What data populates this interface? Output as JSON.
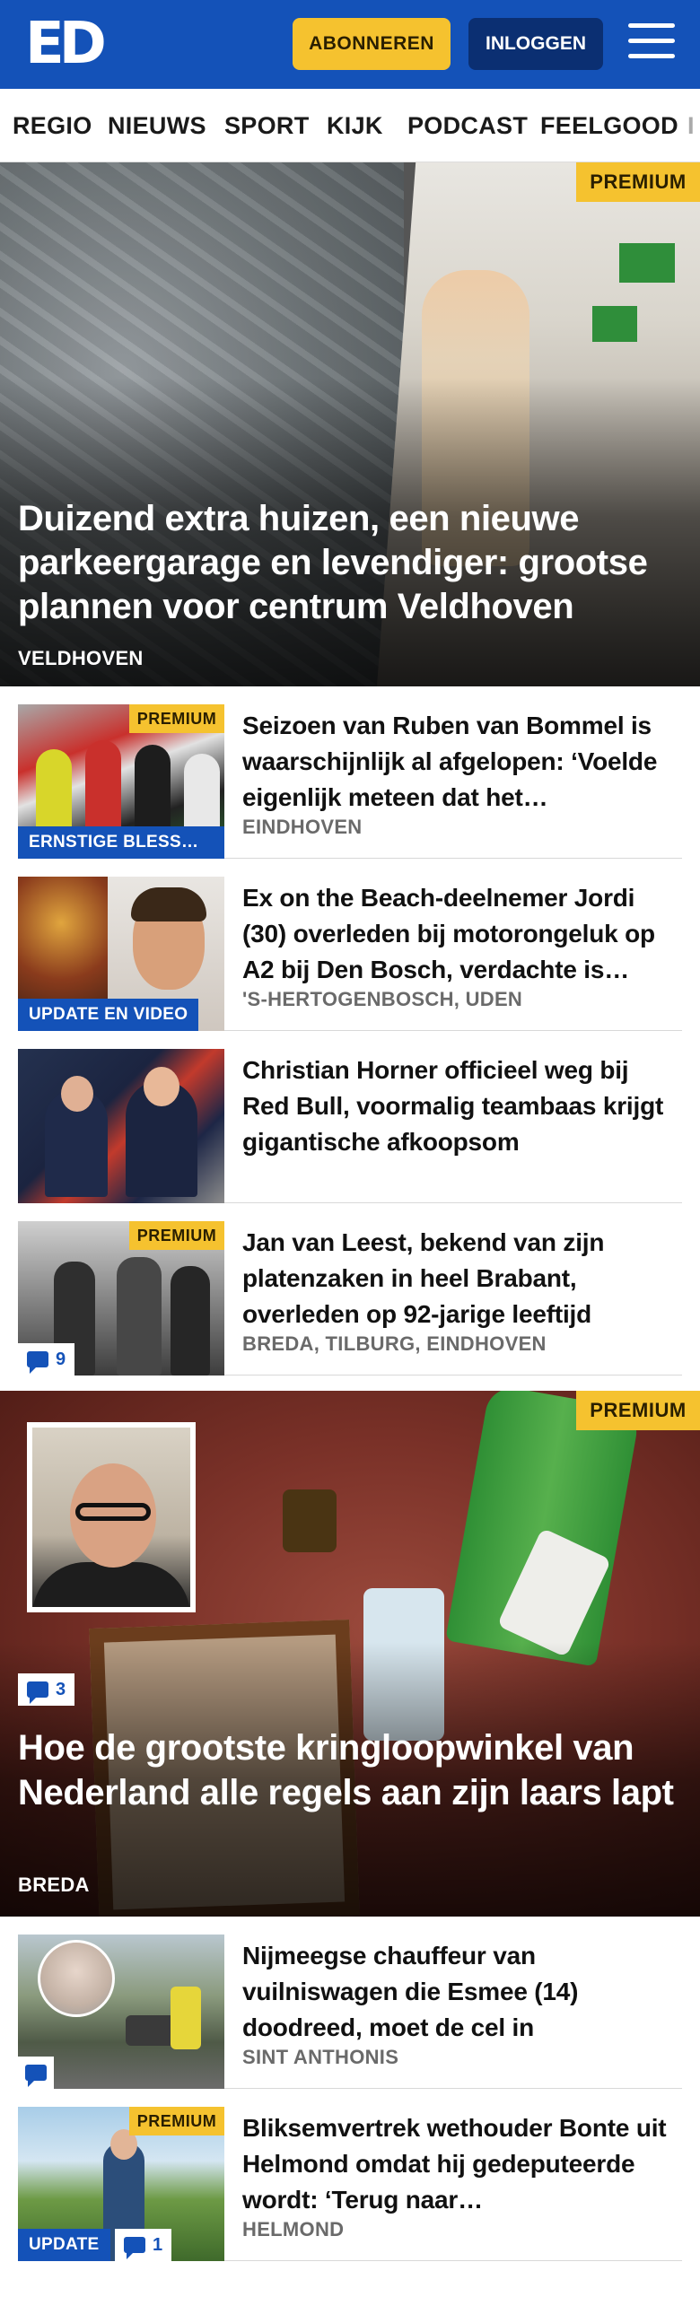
{
  "header": {
    "logo": "ED",
    "subscribe_label": "ABONNEREN",
    "login_label": "INLOGGEN"
  },
  "nav": {
    "items": [
      "REGIO",
      "NIEUWS",
      "SPORT",
      "KIJK",
      "PODCAST",
      "FEELGOOD",
      "I"
    ]
  },
  "hero": {
    "badge": "PREMIUM",
    "title": "Duizend extra huizen, een nieuwe parkeergarage en levendiger: grootse plannen voor centrum Veldhoven",
    "location": "VELDHOVEN"
  },
  "articles": [
    {
      "badge": "PREMIUM",
      "label": "ERNSTIGE BLESS…",
      "title": "Seizoen van Ruben van Bommel is waarschijnlijk al afgelopen: ‘Voelde eigenlijk meteen dat het…",
      "location": "EINDHOVEN"
    },
    {
      "label": "UPDATE EN VIDEO",
      "title": "Ex on the Beach-deelnemer Jordi (30) overleden bij motorongeluk op A2 bij Den Bosch, verdachte is…",
      "location": "'S-HERTOGENBOSCH, UDEN"
    },
    {
      "title": "Christian Horner officieel weg bij Red Bull, voormalig teambaas krijgt gigantische afkoopsom"
    },
    {
      "badge": "PREMIUM",
      "comments": "9",
      "title": "Jan van Leest, bekend van zijn platenzaken in heel Brabant, overleden op 92-jarige leeftijd",
      "location": "BREDA, TILBURG, EINDHOVEN"
    }
  ],
  "feature": {
    "badge": "PREMIUM",
    "comments": "3",
    "title": "Hoe de grootste kringloopwinkel van Nederland alle regels aan zijn laars lapt",
    "location": "BREDA"
  },
  "articles2": [
    {
      "title": "Nijmeegse chauffeur van vuilniswagen die Esmee (14) doodreed, moet de cel in",
      "location": "SINT ANTHONIS"
    },
    {
      "badge": "PREMIUM",
      "label": "UPDATE",
      "comments": "1",
      "title": "Bliksemvertrek wethouder Bonte uit Helmond omdat hij gedeputeerde wordt: ‘Terug naar…",
      "location": "HELMOND"
    }
  ],
  "colors": {
    "brand_blue": "#1452b8",
    "premium_yellow": "#f5c22f",
    "login_dark_blue": "#0b2f72"
  },
  "icons": [
    "ed-logo-icon",
    "hamburger-menu-icon",
    "comment-icon"
  ]
}
